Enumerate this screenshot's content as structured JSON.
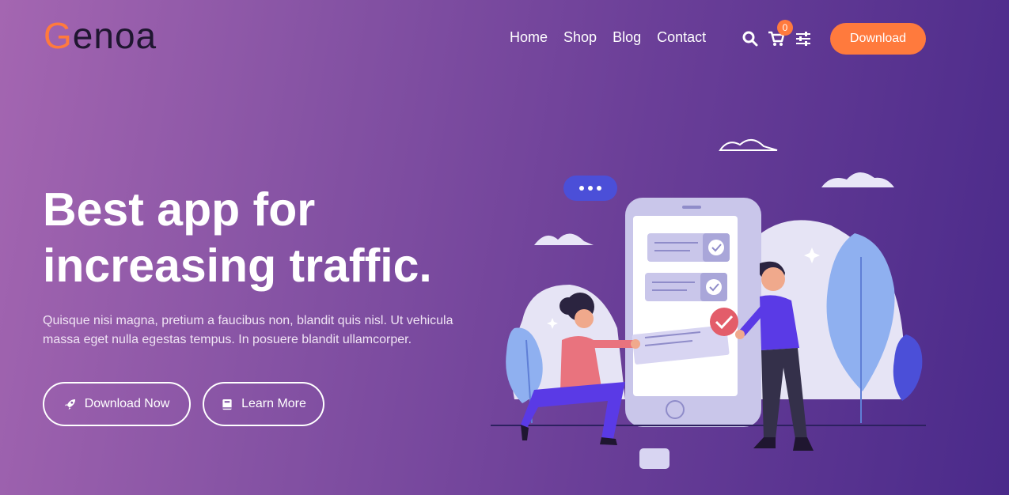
{
  "brand": {
    "logo_first": "G",
    "logo_rest": "enoa"
  },
  "nav": [
    {
      "label": "Home"
    },
    {
      "label": "Shop"
    },
    {
      "label": "Blog"
    },
    {
      "label": "Contact"
    }
  ],
  "header": {
    "cart_count": "0",
    "download_label": "Download"
  },
  "icons": {
    "search": "search-icon",
    "cart": "cart-icon",
    "settings": "settings-sliders-icon",
    "rocket": "rocket-icon",
    "book": "book-icon"
  },
  "hero": {
    "title_line1": "Best app for",
    "title_line2": "increasing traffic.",
    "description": "Quisque nisi magna, pretium a faucibus non, blandit quis nisl. Ut vehicula massa eget nulla egestas tempus. In posuere blandit ullamcorper.",
    "primary_button": "Download Now",
    "secondary_button": "Learn More"
  },
  "colors": {
    "accent": "#ff7a3d",
    "bg_start": "#a466b1",
    "bg_end": "#4a2a8a"
  }
}
